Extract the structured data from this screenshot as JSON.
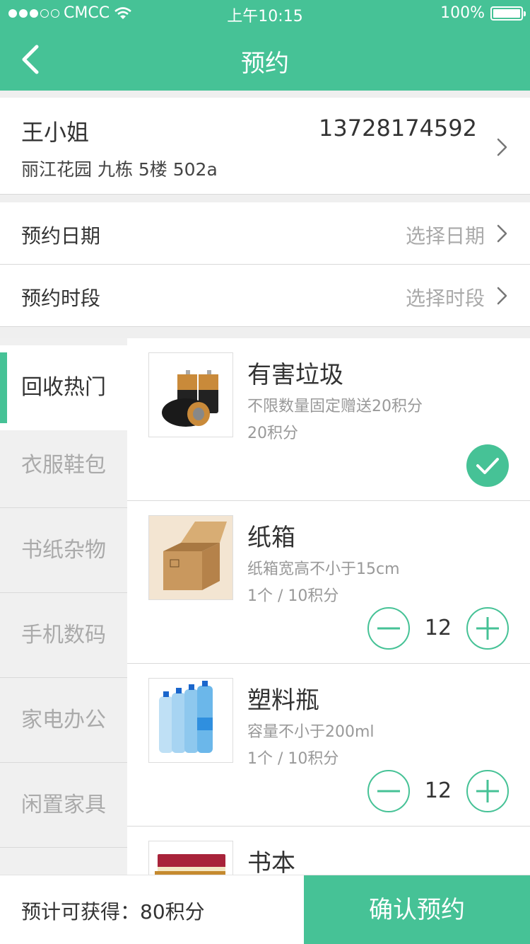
{
  "status_bar": {
    "carrier": "CMCC",
    "time": "上午10:15",
    "battery": "100%",
    "signal_dots": 5,
    "signal_filled": 3
  },
  "nav": {
    "title": "预约",
    "back_icon": "chevron-left-icon"
  },
  "address": {
    "name": "王小姐",
    "phone": "13728174592",
    "detail": "丽江花园 九栋 5楼 502a"
  },
  "appointment": {
    "date_label": "预约日期",
    "date_value": "选择日期",
    "time_label": "预约时段",
    "time_value": "选择时段"
  },
  "categories": [
    "回收热门",
    "衣服鞋包",
    "书纸杂物",
    "手机数码",
    "家电办公",
    "闲置家具"
  ],
  "active_category": "回收热门",
  "products": [
    {
      "name": "有害垃圾",
      "desc": "不限数量固定赠送20积分",
      "price": "20积分",
      "selected": true
    },
    {
      "name": "纸箱",
      "desc": "纸箱宽高不小于15cm",
      "price": "1个 / 10积分",
      "quantity": "12"
    },
    {
      "name": "塑料瓶",
      "desc": "容量不小于200ml",
      "price": "1个 / 10积分",
      "quantity": "12"
    },
    {
      "name": "书本"
    }
  ],
  "footer": {
    "estimate": "预计可获得：80积分",
    "confirm": "确认预约"
  },
  "colors": {
    "accent": "#46c296",
    "gray_text": "#999999",
    "border": "#d9d9d9"
  }
}
